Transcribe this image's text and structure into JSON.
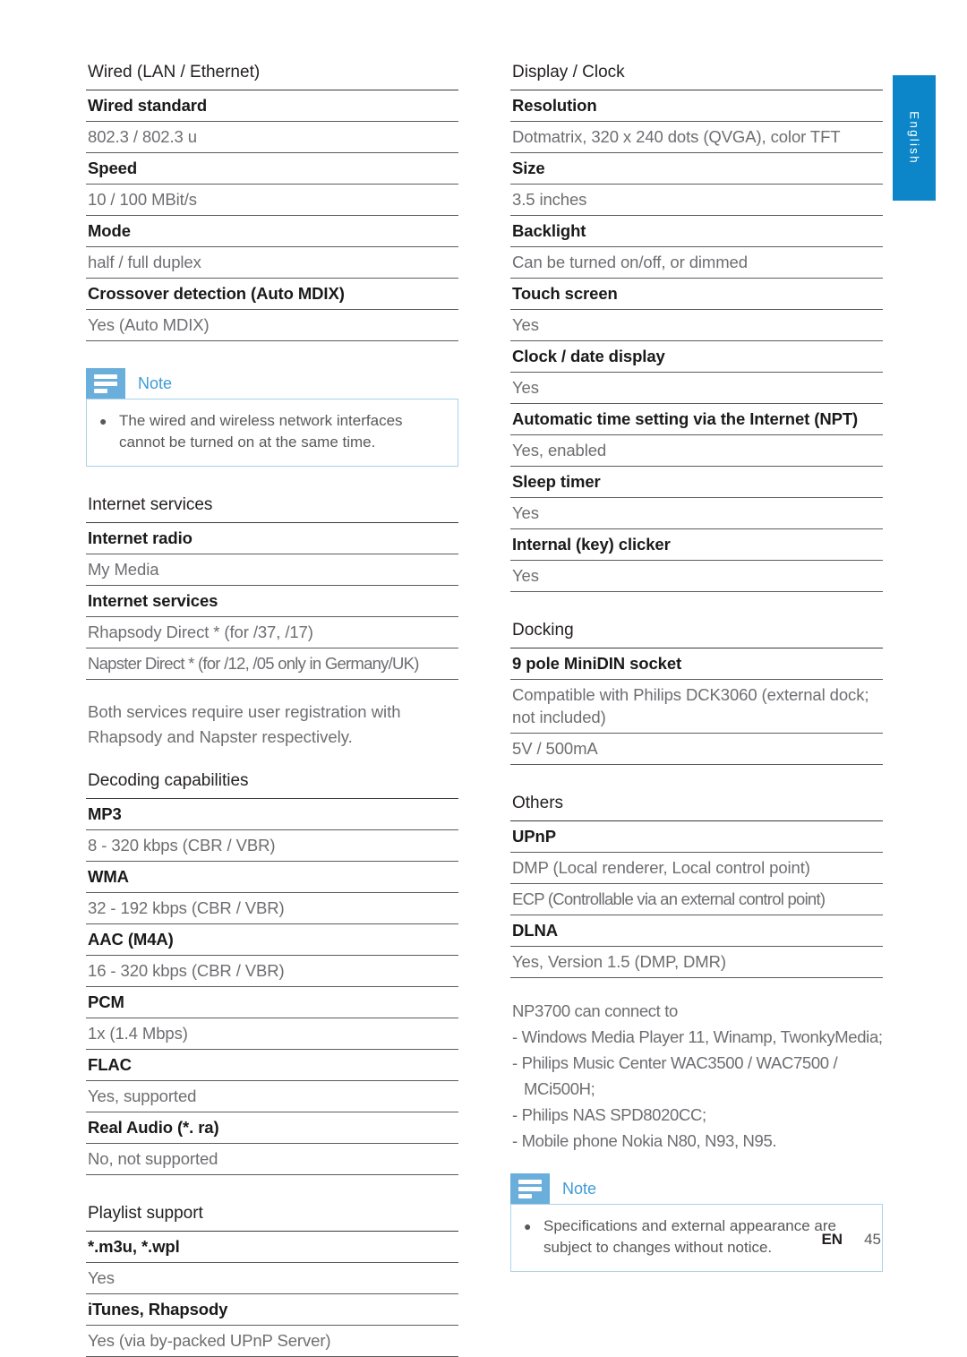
{
  "language_tab": {
    "label": "English"
  },
  "footer": {
    "locale_code": "EN",
    "page_number": "45"
  },
  "left_column": {
    "wired_section": {
      "title": "Wired (LAN / Ethernet)",
      "rows": [
        {
          "type": "label",
          "text": "Wired standard"
        },
        {
          "type": "value",
          "text": "802.3 / 802.3 u"
        },
        {
          "type": "label",
          "text": "Speed"
        },
        {
          "type": "value",
          "text": "10 / 100 MBit/s"
        },
        {
          "type": "label",
          "text": "Mode"
        },
        {
          "type": "value",
          "text": "half / full duplex"
        },
        {
          "type": "label",
          "text": "Crossover detection (Auto MDIX)"
        },
        {
          "type": "value",
          "text": "Yes (Auto MDIX)"
        }
      ]
    },
    "note": {
      "icon": "note-icon",
      "title": "Note",
      "bullet": "The wired and wireless network interfaces cannot be turned on at the same time."
    },
    "internet_services_section": {
      "title": "Internet services",
      "rows": [
        {
          "type": "label",
          "text": "Internet radio"
        },
        {
          "type": "value",
          "text": "My Media"
        },
        {
          "type": "label",
          "text": "Internet services"
        },
        {
          "type": "value",
          "text": "Rhapsody Direct * (for /37, /17)"
        },
        {
          "type": "value",
          "text": "Napster Direct * (for /12, /05 only in Germany/UK)"
        }
      ]
    },
    "registration_note": "Both services require user registration with Rhapsody and Napster respectively.",
    "decoding_section": {
      "title": "Decoding capabilities",
      "rows": [
        {
          "type": "label",
          "text": "MP3"
        },
        {
          "type": "value",
          "text": "8 - 320 kbps (CBR / VBR)"
        },
        {
          "type": "label",
          "text": "WMA"
        },
        {
          "type": "value",
          "text": "32 - 192 kbps (CBR / VBR)"
        },
        {
          "type": "label",
          "text": "AAC (M4A)"
        },
        {
          "type": "value",
          "text": "16 - 320 kbps (CBR / VBR)"
        },
        {
          "type": "label",
          "text": "PCM"
        },
        {
          "type": "value",
          "text": "1x (1.4 Mbps)"
        },
        {
          "type": "label",
          "text": "FLAC"
        },
        {
          "type": "value",
          "text": "Yes, supported"
        },
        {
          "type": "label",
          "text": "Real Audio (*. ra)"
        },
        {
          "type": "value",
          "text": "No, not supported"
        }
      ]
    },
    "playlist_section": {
      "title": "Playlist support",
      "rows": [
        {
          "type": "label",
          "text": "*.m3u, *.wpl"
        },
        {
          "type": "value",
          "text": "Yes"
        },
        {
          "type": "label",
          "text": "iTunes, Rhapsody"
        },
        {
          "type": "value",
          "text": "Yes (via by-packed UPnP Server)"
        }
      ]
    }
  },
  "right_column": {
    "display_section": {
      "title": "Display / Clock",
      "rows": [
        {
          "type": "label",
          "text": "Resolution"
        },
        {
          "type": "value",
          "text": "Dotmatrix, 320 x 240 dots (QVGA), color TFT"
        },
        {
          "type": "label",
          "text": "Size"
        },
        {
          "type": "value",
          "text": "3.5 inches"
        },
        {
          "type": "label",
          "text": "Backlight"
        },
        {
          "type": "value",
          "text": "Can be turned on/off, or dimmed"
        },
        {
          "type": "label",
          "text": "Touch screen"
        },
        {
          "type": "value",
          "text": "Yes"
        },
        {
          "type": "label",
          "text": "Clock / date display"
        },
        {
          "type": "value",
          "text": "Yes"
        },
        {
          "type": "label",
          "text": "Automatic time setting via the Internet (NPT)"
        },
        {
          "type": "value",
          "text": "Yes, enabled"
        },
        {
          "type": "label",
          "text": "Sleep timer"
        },
        {
          "type": "value",
          "text": "Yes"
        },
        {
          "type": "label",
          "text": "Internal (key) clicker"
        },
        {
          "type": "value",
          "text": "Yes"
        }
      ]
    },
    "docking_section": {
      "title": "Docking",
      "rows": [
        {
          "type": "label",
          "text": "9 pole MiniDIN socket"
        },
        {
          "type": "value",
          "text": "Compatible with Philips DCK3060 (external dock; not included)"
        },
        {
          "type": "value",
          "text": "5V / 500mA"
        }
      ]
    },
    "others_section": {
      "title": "Others",
      "rows": [
        {
          "type": "label",
          "text": "UPnP"
        },
        {
          "type": "value",
          "text": "DMP (Local renderer, Local control point)"
        },
        {
          "type": "value",
          "text": "ECP (Controllable via an external control point)"
        },
        {
          "type": "label",
          "text": "DLNA"
        },
        {
          "type": "value",
          "text": "Yes, Version 1.5 (DMP, DMR)"
        }
      ]
    },
    "connectivity": {
      "intro": "NP3700 can connect to",
      "items": [
        "- Windows Media Player 11, Winamp, TwonkyMedia;",
        "- Philips Music Center WAC3500 / WAC7500 /",
        "MCi500H;",
        "- Philips NAS SPD8020CC;",
        "- Mobile phone Nokia N80, N93, N95."
      ]
    },
    "note": {
      "icon": "note-icon",
      "title": "Note",
      "bullet": "Specifications and external appearance are subject to changes without notice."
    }
  }
}
